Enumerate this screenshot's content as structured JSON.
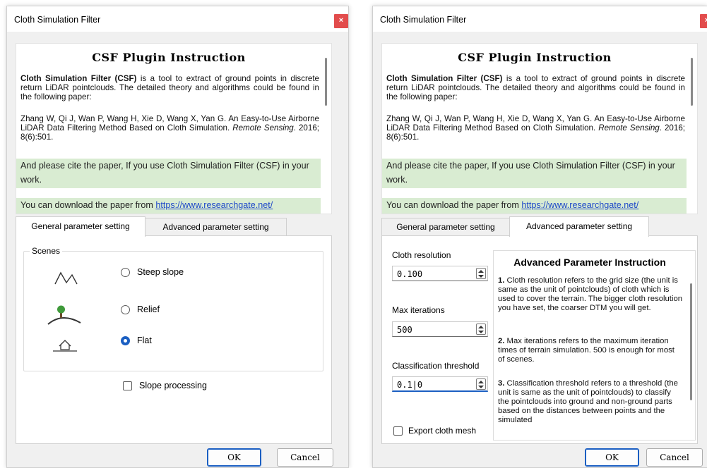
{
  "dialog_title": "Cloth Simulation Filter",
  "close_symbol": "×",
  "instructions": {
    "heading": "CSF Plugin Instruction",
    "intro_bold": "Cloth Simulation Filter (CSF)",
    "intro_rest": " is a tool to extract of ground points in discrete return LiDAR pointclouds. The detailed theory and algorithms could be found in the following paper:",
    "citation_main": "Zhang W, Qi J, Wan P, Wang H, Xie D, Wang X, Yan G. An Easy-to-Use Airborne LiDAR Data Filtering Method Based on Cloth Simulation. ",
    "citation_journal": "Remote Sensing",
    "citation_end": ". 2016; 8(6):501.",
    "cite_note": "And please cite the paper, If you use Cloth Simulation Filter (CSF) in your work.",
    "download_text": "You can download the paper from ",
    "download_link": "https://www.researchgate.net/"
  },
  "tabs": {
    "general": "General parameter setting",
    "advanced": "Advanced parameter setting"
  },
  "general": {
    "scenes_label": "Scenes",
    "options": [
      {
        "label": "Steep slope",
        "checked": false,
        "icon": "steep-slope-icon"
      },
      {
        "label": "Relief",
        "checked": false,
        "icon": "relief-icon"
      },
      {
        "label": "Flat",
        "checked": true,
        "icon": "flat-house-icon"
      }
    ],
    "slope_processing_label": "Slope processing"
  },
  "advanced": {
    "cloth_resolution_label": "Cloth resolution",
    "cloth_resolution_value": "0.100",
    "max_iterations_label": "Max iterations",
    "max_iterations_value": "500",
    "classification_threshold_label": "Classification threshold",
    "classification_threshold_value": "0.1|0",
    "export_cloth_mesh_label": "Export cloth mesh",
    "instruction_heading": "Advanced Parameter Instruction",
    "item1_num": "1.",
    "item1_text": " Cloth resolution refers to the grid size (the unit is same as the unit of pointclouds) of cloth which is used to cover the terrain. The bigger cloth resolution you have set, the coarser DTM  you will get.",
    "item2_num": "2.",
    "item2_text": " Max iterations refers to the maximum iteration times of terrain simulation. 500 is enough for most of scenes.",
    "item3_num": "3.",
    "item3_text": " Classification threshold refers to a threshold (the unit is same as the unit of pointclouds) to classify the pointclouds into ground and non-ground parts based on the distances between points and the simulated"
  },
  "buttons": {
    "ok": "OK",
    "cancel": "Cancel"
  },
  "colors": {
    "accent": "#1b5fc2",
    "close_red": "#e24c4c",
    "highlight_green": "#d9ecd2",
    "link_blue": "#1e48c9"
  }
}
